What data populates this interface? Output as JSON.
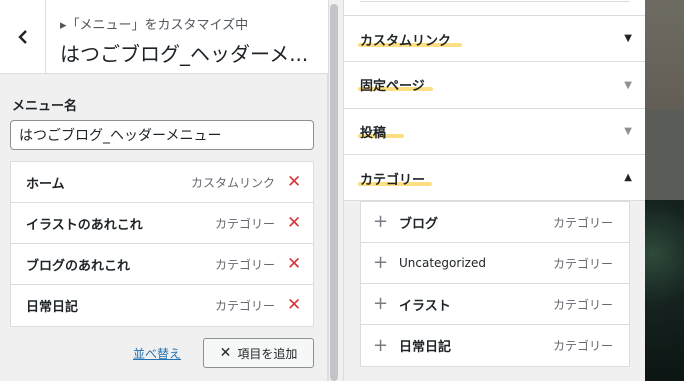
{
  "header": {
    "subtitle": "▸「メニュー」をカスタマイズ中",
    "title": "はつごブログ_ヘッダーメ..."
  },
  "menu_name": {
    "label": "メニュー名",
    "value": "はつごブログ_ヘッダーメニュー"
  },
  "menu_items": [
    {
      "title": "ホーム",
      "type": "カスタムリンク"
    },
    {
      "title": "イラストのあれこれ",
      "type": "カテゴリー"
    },
    {
      "title": "ブログのあれこれ",
      "type": "カテゴリー"
    },
    {
      "title": "日常日記",
      "type": "カテゴリー"
    }
  ],
  "actions": {
    "reorder": "並べ替え",
    "add_items": "項目を追加"
  },
  "sections": {
    "custom_link": "カスタムリンク",
    "pages": "固定ページ",
    "posts": "投稿",
    "categories": "カテゴリー"
  },
  "category_items": [
    {
      "name": "ブログ",
      "type": "カテゴリー"
    },
    {
      "name": "Uncategorized",
      "type": "カテゴリー"
    },
    {
      "name": "イラスト",
      "type": "カテゴリー"
    },
    {
      "name": "日常日記",
      "type": "カテゴリー"
    }
  ],
  "colors": {
    "delete": "#d63638",
    "link": "#2271b1",
    "highlight": "#fdda73"
  }
}
